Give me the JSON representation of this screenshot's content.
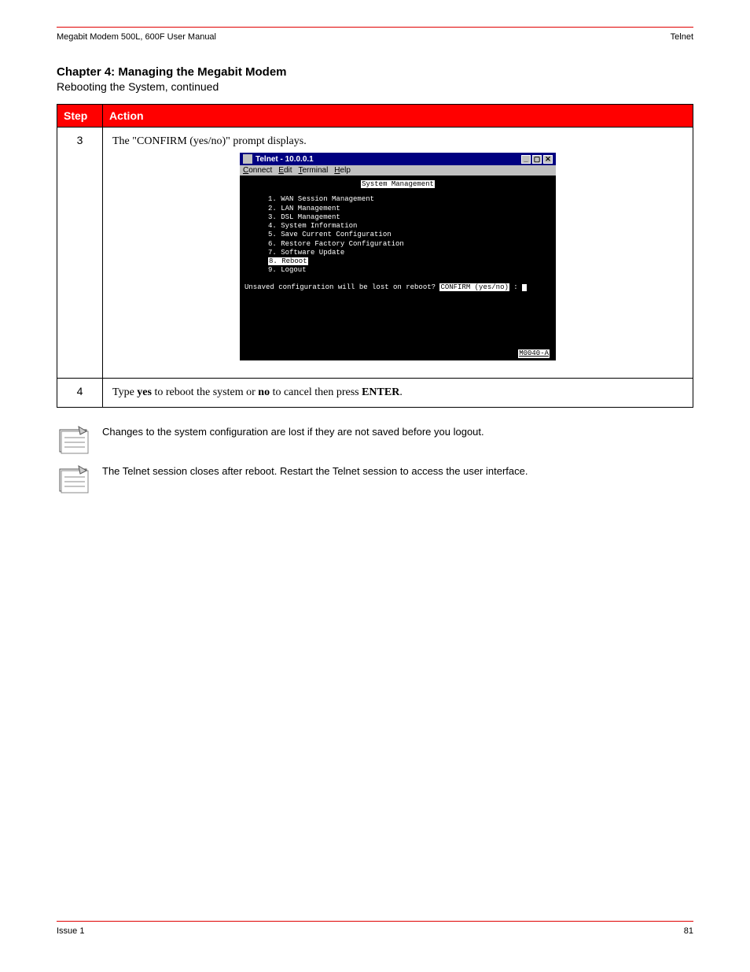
{
  "header": {
    "left": "Megabit Modem 500L, 600F User Manual",
    "right": "Telnet"
  },
  "headings": {
    "chapter": "Chapter 4: Managing the Megabit Modem",
    "section": "Rebooting the System, continued"
  },
  "table": {
    "col_step": "Step",
    "col_action": "Action",
    "rows": [
      {
        "step": "3",
        "action": "The \"CONFIRM (yes/no)\" prompt displays."
      },
      {
        "step": "4",
        "action_prefix": "Type ",
        "action_cmd1": "yes",
        "action_mid": " to reboot the system or ",
        "action_cmd2": "no",
        "action_suffix": " to cancel then press ",
        "action_key": "ENTER",
        "action_end": "."
      }
    ]
  },
  "telnet": {
    "title": "Telnet - 10.0.0.1",
    "menus": [
      "Connect",
      "Edit",
      "Terminal",
      "Help"
    ],
    "sys_title": "System Management",
    "items": [
      "1. WAN Session Management",
      "2. LAN Management",
      "3. DSL Management",
      "4. System Information",
      "5. Save Current Configuration",
      "6. Restore Factory Configuration",
      "7. Software Update",
      "8. Reboot",
      "9. Logout"
    ],
    "highlight_index": 7,
    "prompt_prefix": "Unsaved configuration will be lost on reboot? ",
    "prompt_confirm": "CONFIRM (yes/no)",
    "prompt_suffix": " : ",
    "ref": "M0040-A"
  },
  "notes": [
    "Changes to the system configuration are lost if they are not saved before you logout.",
    "The Telnet session closes after reboot. Restart the Telnet session to access the user interface."
  ],
  "footer": {
    "left": "Issue 1",
    "right": "81"
  }
}
